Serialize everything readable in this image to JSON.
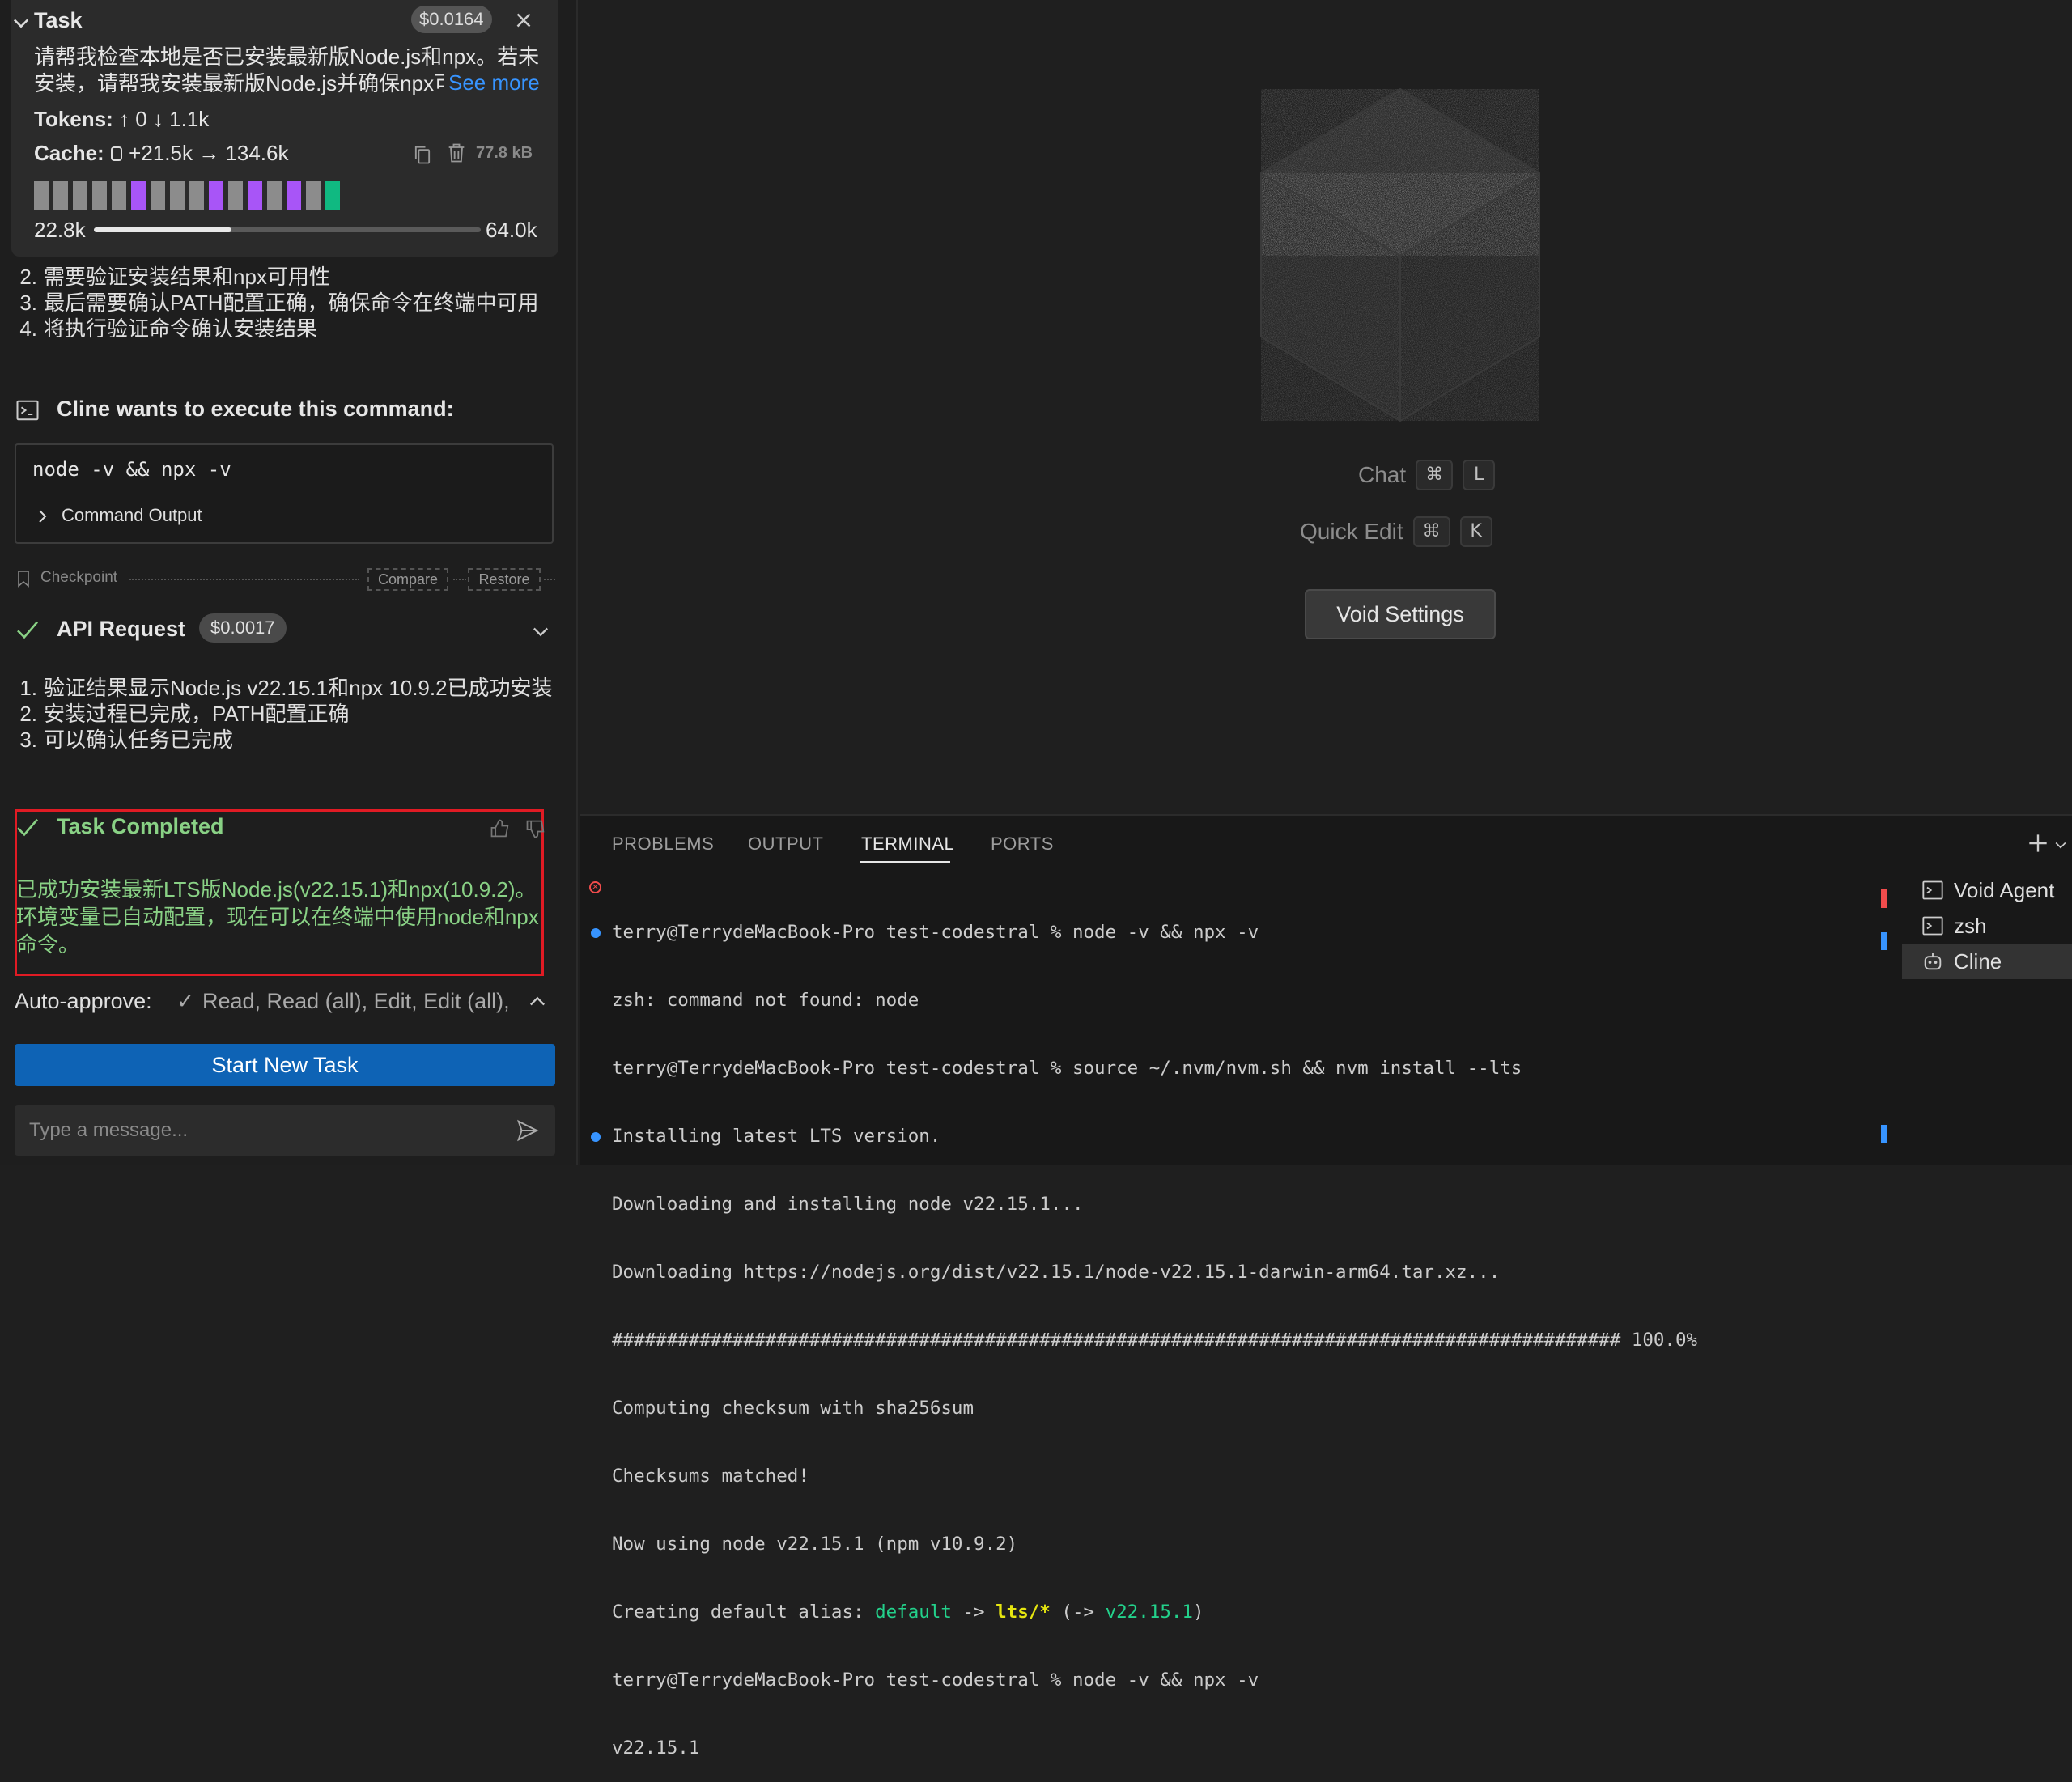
{
  "task": {
    "title": "Task",
    "cost": "$0.0164",
    "text": "请帮我检查本地是否已安装最新版Node.js和npx。若未安装，请帮我安装最新版Node.js并确保npx可用",
    "see_more": "See more",
    "tokens_label": "Tokens:",
    "tokens_value": "↑ 0 ↓ 1.1k",
    "cache_label": "Cache:",
    "cache_value": "+21.5k → 134.6k",
    "size": "77.8 kB",
    "context_min": "22.8k",
    "context_max": "64.0k",
    "context_fraction": 0.356,
    "context_blocks": [
      "#8c8c8c",
      "#8c8c8c",
      "#8c8c8c",
      "#8c8c8c",
      "#8c8c8c",
      "#a855f7",
      "#8c8c8c",
      "#8c8c8c",
      "#8c8c8c",
      "#a855f7",
      "#8c8c8c",
      "#a855f7",
      "#8c8c8c",
      "#a855f7",
      "#8c8c8c",
      "#10b981"
    ]
  },
  "steps_before": [
    {
      "num": "2.",
      "text": "需要验证安装结果和npx可用性"
    },
    {
      "num": "3.",
      "text": "最后需要确认PATH配置正确，确保命令在终端中可用"
    },
    {
      "num": "4.",
      "text": "将执行验证命令确认安装结果"
    }
  ],
  "command_header": "Cline wants to execute this command:",
  "command": "node -v && npx -v",
  "command_output_label": "Command Output",
  "checkpoint": {
    "label": "Checkpoint",
    "compare": "Compare",
    "restore": "Restore"
  },
  "api_request": {
    "label": "API Request",
    "cost": "$0.0017"
  },
  "steps_after": [
    {
      "num": "1.",
      "text": "验证结果显示Node.js v22.15.1和npx 10.9.2已成功安装"
    },
    {
      "num": "2.",
      "text": "安装过程已完成，PATH配置正确"
    },
    {
      "num": "3.",
      "text": "可以确认任务已完成"
    }
  ],
  "completed": {
    "title": "Task Completed",
    "text": "已成功安装最新LTS版Node.js(v22.15.1)和npx(10.9.2)。环境变量已自动配置，现在可以在终端中使用node和npx命令。"
  },
  "auto_approve": {
    "label": "Auto-approve:",
    "check": "✓",
    "items": "Read, Read (all), Edit, Edit (all),"
  },
  "start_new_task": "Start New Task",
  "message_placeholder": "Type a message...",
  "editor": {
    "chat_label": "Chat",
    "chat_key1": "⌘",
    "chat_key2": "L",
    "quick_edit_label": "Quick Edit",
    "qe_key1": "⌘",
    "qe_key2": "K",
    "void_settings": "Void Settings"
  },
  "panel_tabs": [
    "PROBLEMS",
    "OUTPUT",
    "TERMINAL",
    "PORTS"
  ],
  "terminal": {
    "lines": [
      "terry@TerrydeMacBook-Pro test-codestral % node -v && npx -v",
      "zsh: command not found: node",
      "terry@TerrydeMacBook-Pro test-codestral % source ~/.nvm/nvm.sh && nvm install --lts",
      "Installing latest LTS version.",
      "Downloading and installing node v22.15.1...",
      "Downloading https://nodejs.org/dist/v22.15.1/node-v22.15.1-darwin-arm64.tar.xz...",
      "############################################################################################ 100.0%",
      "Computing checksum with sha256sum",
      "Checksums matched!",
      "Now using node v22.15.1 (npm v10.9.2)",
      "terry@TerrydeMacBook-Pro test-codestral % node -v && npx -v",
      "v22.15.1"
    ],
    "alias_prefix": "Creating default alias: ",
    "alias_default": "default",
    "alias_arrow": " -> ",
    "alias_lts": "lts/*",
    "alias_open": " (-> ",
    "alias_version": "v22.15.1",
    "alias_close": ")"
  },
  "terminal_list": [
    "Void Agent",
    "zsh",
    "Cline"
  ]
}
